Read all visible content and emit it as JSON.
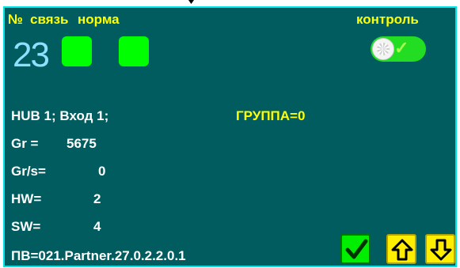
{
  "header": {
    "number_label": "№",
    "link_label": "связь",
    "norm_label": "норма",
    "control_label": "контроль"
  },
  "device_number": "23",
  "indicators": {
    "link": {
      "state": "on",
      "color": "#00ff00"
    },
    "norm": {
      "state": "on",
      "color": "#00ff00"
    }
  },
  "control_toggle": {
    "state": "on"
  },
  "info": {
    "hub_line": "HUB   1;  Вход  1;",
    "group_line": "ГРУППА=0",
    "gr_label": "Gr  =",
    "gr_value": "5675",
    "grs_label": "Gr/s=",
    "grs_value": "0",
    "hw_label": "HW=",
    "hw_value": "2",
    "sw_label": "SW=",
    "sw_value": "4"
  },
  "firmware": "ПВ=021.Partner.27.0.2.2.0.1",
  "buttons": {
    "ok_icon": "check-icon",
    "up_icon": "arrow-up-icon",
    "down_icon": "arrow-down-icon"
  },
  "colors": {
    "background": "#005c5f",
    "border": "#00e4e6",
    "label": "#ffff00",
    "value": "#ffffff",
    "indicator_on": "#00ff00"
  }
}
